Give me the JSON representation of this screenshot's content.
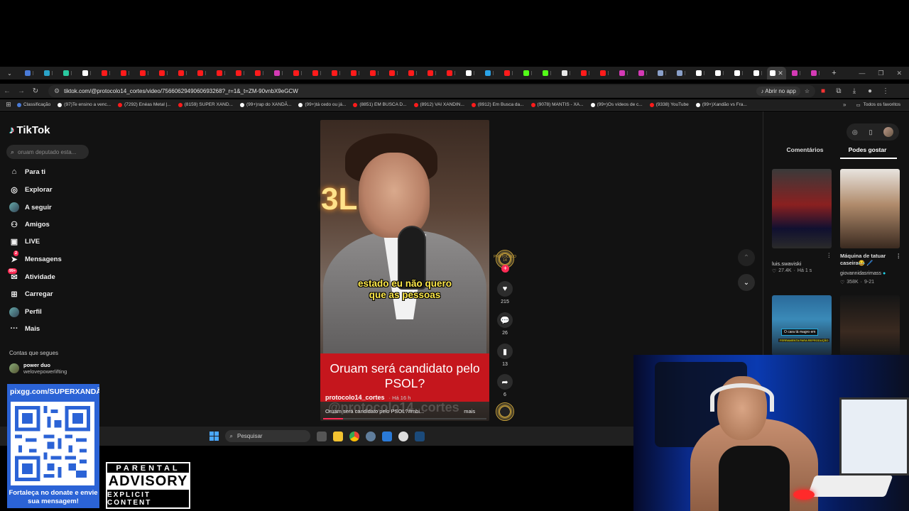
{
  "browser": {
    "url": "tiktok.com/@protocolo14_cortes/video/7566062949060693268?_r=1&_t=ZM-90vnbX9eGCW",
    "open_app": "Abrir no app",
    "tabs": [
      {
        "color": "#4a7bd8"
      },
      {
        "color": "#2aa3c9"
      },
      {
        "color": "#2ac9a0"
      },
      {
        "color": "#ffffff"
      },
      {
        "color": "#ff1b1b"
      },
      {
        "color": "#ff1b1b"
      },
      {
        "color": "#ff1b1b"
      },
      {
        "color": "#ff1b1b"
      },
      {
        "color": "#ff1b1b"
      },
      {
        "color": "#ff1b1b"
      },
      {
        "color": "#ff1b1b"
      },
      {
        "color": "#ff1b1b"
      },
      {
        "color": "#ff1b1b"
      },
      {
        "color": "#d43ab5"
      },
      {
        "color": "#ff1b1b"
      },
      {
        "color": "#ff1b1b"
      },
      {
        "color": "#ff1b1b"
      },
      {
        "color": "#ff1b1b"
      },
      {
        "color": "#ff1b1b"
      },
      {
        "color": "#ff1b1b"
      },
      {
        "color": "#ff1b1b"
      },
      {
        "color": "#ff1b1b"
      },
      {
        "color": "#ff1b1b"
      },
      {
        "color": "#ffffff"
      },
      {
        "color": "#2aa3e8"
      },
      {
        "color": "#ff1b1b"
      },
      {
        "color": "#53fc18"
      },
      {
        "color": "#53fc18"
      },
      {
        "color": "#e8e8e8"
      },
      {
        "color": "#ff1b1b"
      },
      {
        "color": "#ff1b1b"
      },
      {
        "color": "#d43ab5"
      },
      {
        "color": "#d43ab5"
      },
      {
        "color": "#8aa0c9"
      },
      {
        "color": "#8aa0c9"
      },
      {
        "color": "#ffffff"
      },
      {
        "color": "#ffffff"
      },
      {
        "color": "#ffffff"
      },
      {
        "color": "#ffffff"
      },
      {
        "color": "#ffffff",
        "active": true
      },
      {
        "color": "#d43ab5"
      },
      {
        "color": "#d43ab5"
      }
    ],
    "bookmarks": [
      {
        "label": "Classificação",
        "color": "#4a7bd8"
      },
      {
        "label": "(97)Te ensino a venc...",
        "color": "#ffffff"
      },
      {
        "label": "(7292) Enéas Metal |...",
        "color": "#ff1b1b"
      },
      {
        "label": "(8159) SUPER XAND...",
        "color": "#ff1b1b"
      },
      {
        "label": "(99+)rap do XANDÃ...",
        "color": "#ffffff"
      },
      {
        "label": "(99+)tá cedo ou já...",
        "color": "#ffffff"
      },
      {
        "label": "(8851) EM BUSCA D...",
        "color": "#ff1b1b"
      },
      {
        "label": "(8912) VAI XANDIN...",
        "color": "#ff1b1b"
      },
      {
        "label": "(8912) Em Busca da...",
        "color": "#ff1b1b"
      },
      {
        "label": "(9078) MANTIS - XA...",
        "color": "#ff1b1b"
      },
      {
        "label": "(99+)Os vídeos de c...",
        "color": "#ffffff"
      },
      {
        "label": "(9338) YouTube",
        "color": "#ff1b1b"
      },
      {
        "label": "(99+)Xandão vs Fra...",
        "color": "#ffffff"
      }
    ],
    "all_favorites": "Todos os favoritos"
  },
  "tiktok": {
    "logo": "TikTok",
    "search_placeholder": "oruam deputado esta...",
    "nav": [
      {
        "label": "Para ti",
        "icon": "home-icon"
      },
      {
        "label": "Explorar",
        "icon": "compass-icon"
      },
      {
        "label": "A seguir",
        "icon": "following-avatar-icon"
      },
      {
        "label": "Amigos",
        "icon": "friends-icon"
      },
      {
        "label": "LIVE",
        "icon": "live-icon"
      },
      {
        "label": "Mensagens",
        "icon": "messages-icon",
        "badge": "2"
      },
      {
        "label": "Atividade",
        "icon": "activity-icon",
        "badge": "99+"
      },
      {
        "label": "Carregar",
        "icon": "upload-icon"
      },
      {
        "label": "Perfil",
        "icon": "profile-icon"
      },
      {
        "label": "Mais",
        "icon": "more-icon"
      }
    ],
    "following_title": "Contas que segues",
    "following": [
      {
        "name": "power duo",
        "handle": "welovepowerlifting"
      }
    ],
    "video": {
      "neon_text": "3L",
      "subtitle_line1": "estado eu não quero",
      "subtitle_line2": "que as pessoas",
      "headline": "Oruam será candidato pelo PSOL?",
      "watermark": "@protocolo14_cortes",
      "author": "protocolo14_cortes",
      "time": "Há 16 h",
      "caption": "Oruam será candidato pelo PSOL?#mbi...",
      "more": "mais",
      "progress": 0.12,
      "avatar_text": "PROTOCOLO 14"
    },
    "actions": {
      "likes": "215",
      "comments": "26",
      "saves": "13",
      "shares": "6"
    },
    "right_panel": {
      "tabs": [
        "Comentários",
        "Podes gostar"
      ],
      "active_tab": "Podes gostar",
      "items": [
        {
          "author": "luis.swaviski",
          "likes": "27.4K",
          "time": "Há 1 s",
          "title": ""
        },
        {
          "author": "giovannidasrimass",
          "likes": "358K",
          "time": "9-21",
          "title": "Máquina de tatuar caseira😂 🖊️"
        }
      ],
      "thumb3_text": "O cara tá magro em",
      "thumb3_subtext": "FERRAMENTA PARA REPRODUÇÃO"
    }
  },
  "taskbar": {
    "search_placeholder": "Pesquisar"
  },
  "overlay": {
    "donate_url": "pixgg.com/SUPERXANDÃO",
    "donate_text": "Fortaleça no donate e envie sua mensagem!",
    "parental_1": "PARENTAL",
    "parental_2": "ADVISORY",
    "parental_3": "EXPLICIT CONTENT"
  }
}
